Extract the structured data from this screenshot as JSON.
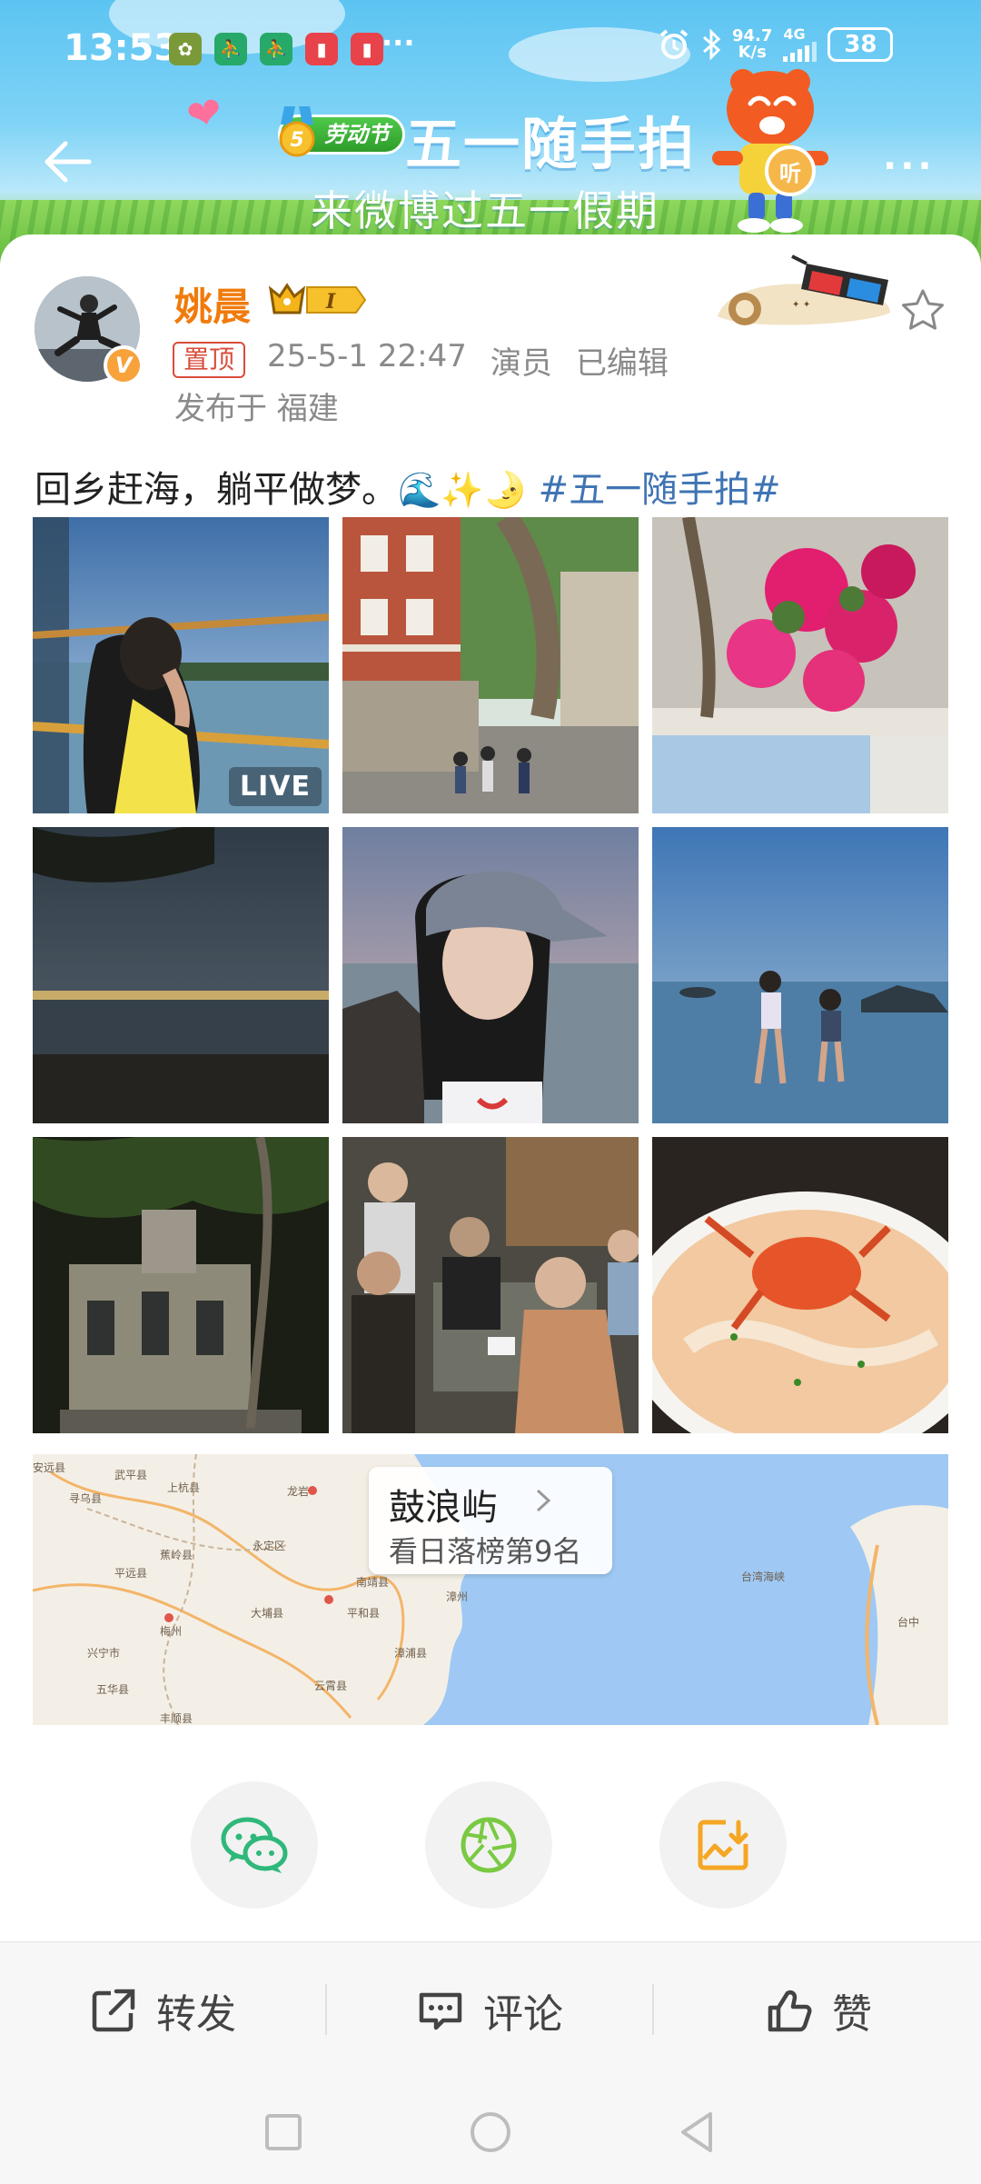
{
  "status_bar": {
    "time": "13:53",
    "more": "···",
    "net_speed_value": "94.7",
    "net_speed_unit": "K/s",
    "network": "4G",
    "battery": "38"
  },
  "banner": {
    "badge": "劳动节",
    "title": "五一随手拍",
    "subtitle": "来微博过五一假期",
    "listen": "听",
    "more": "···"
  },
  "post": {
    "username": "姚晨",
    "pin_tag": "置顶",
    "timestamp": "25-5-1 22:47",
    "role": "演员",
    "edited": "已编辑",
    "location": "发布于 福建",
    "text": "回乡赶海，躺平做梦。",
    "emojis": "🌊✨🌛",
    "hashtag": "#五一随手拍#",
    "live_label": "LIVE"
  },
  "map": {
    "place": "鼓浪屿",
    "rank": "看日落榜第9名",
    "towns": [
      "龙岩",
      "漳州",
      "梅州",
      "平和县",
      "南靖县",
      "云霄县",
      "大埔县",
      "永定区",
      "上杭县",
      "武平县",
      "寻乌县",
      "平远县",
      "蕉岭县",
      "兴宁市",
      "五华县",
      "丰顺县",
      "漳浦县",
      "台湾海峡",
      "台中",
      "安远县"
    ]
  },
  "actions": {
    "repost": "转发",
    "comment": "评论",
    "like": "赞"
  },
  "colors": {
    "username": "#f07b0c",
    "hashtag": "#3f74b3",
    "wechat": "#2fb87a",
    "moments": "#7ac943",
    "save": "#f5a623"
  }
}
